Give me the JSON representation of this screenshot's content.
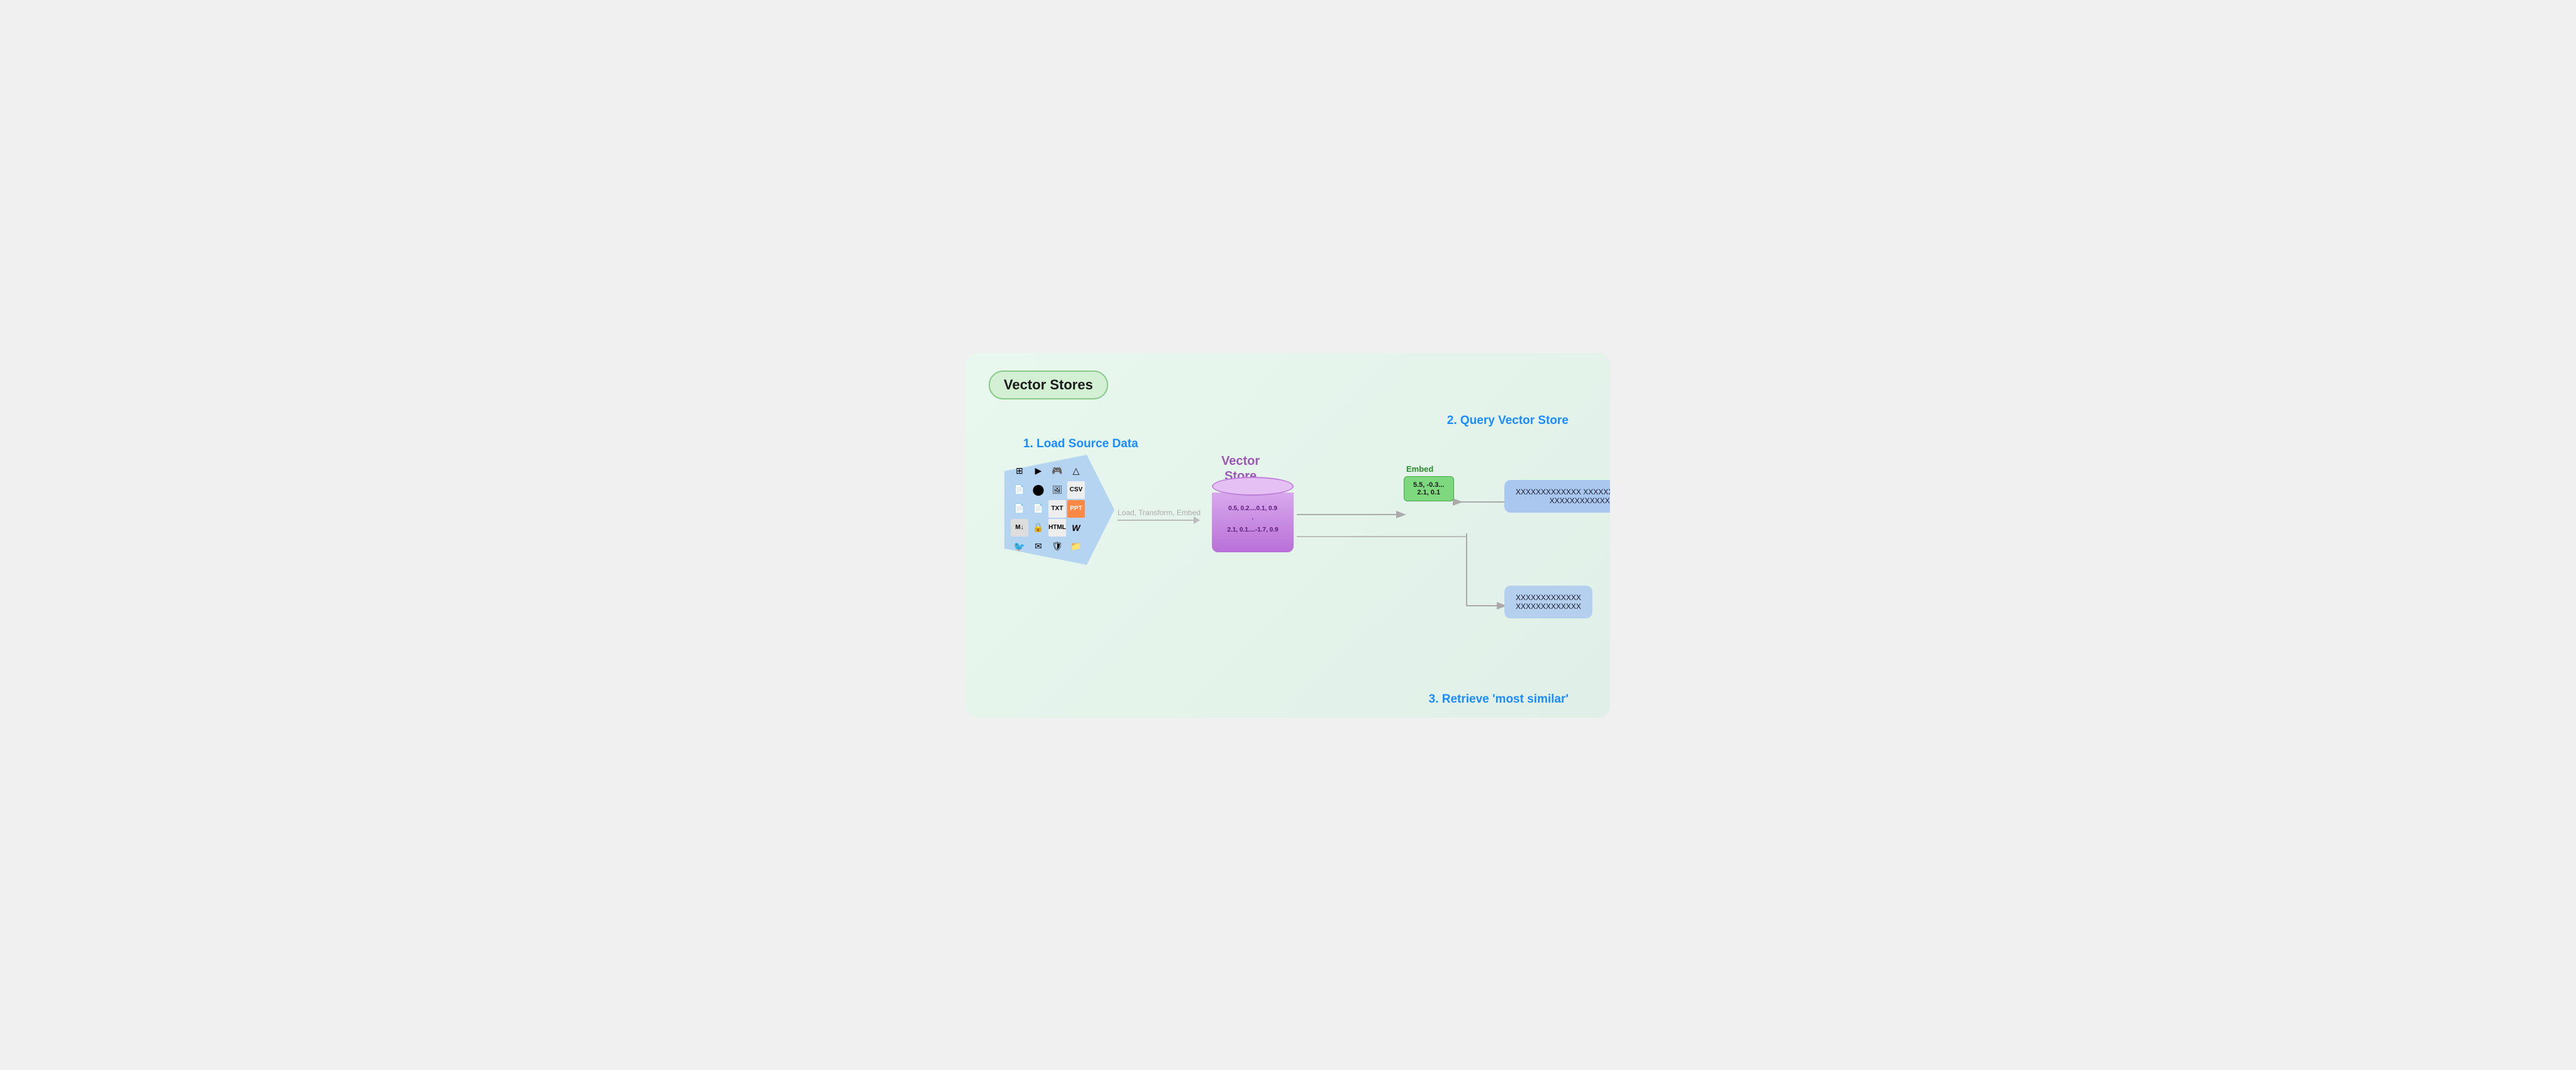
{
  "title": "Vector Stores",
  "section1_label": "1. Load Source Data",
  "section2_label": "2. Query Vector Store",
  "section3_label": "3. Retrieve 'most similar'",
  "vector_store_label": "Vector\nStore",
  "arrow_label": "Load, Transform, Embed",
  "embed_label": "Embed",
  "embed_values": "5.5, -0.3...\n2.1, 0.1",
  "cylinder_text_top": "0.5, 0.2....0.1, 0.9",
  "cylinder_text_mid": "·",
  "cylinder_text_bot": "2.1, 0.1....-1.7, 0.9",
  "query_box_text": "XXXXXXXXXXXXX\nXXXXXXXXXXXXX",
  "result1_text": "XXXXXXXXXXXXX\nXXXXXXXXXXXXX",
  "icons": [
    "#",
    "▶",
    "🎮",
    "△",
    "⊙",
    "📄",
    "📄",
    "📄",
    "📄",
    "📄",
    "📄",
    "📄",
    "📄",
    "📄",
    "📄",
    "📄",
    "📄",
    "📄",
    "📄",
    "📄",
    "🐦",
    "✉",
    "⊙",
    "📁"
  ],
  "colors": {
    "background": "#e8f5ee",
    "title_bg": "#d0ecd0",
    "title_border": "#88bb88",
    "section_color": "#1a8cff",
    "vs_color": "#9b59b6",
    "embed_bg": "#7ed87e",
    "embed_border": "#4aaa4a",
    "embed_label_color": "#2a8a2a",
    "query_box_bg": "#aac8ef",
    "result_box_bg": "#b4d0ee",
    "cylinder_bg": "#c890e0",
    "arrow_color": "#aaaaaa"
  }
}
